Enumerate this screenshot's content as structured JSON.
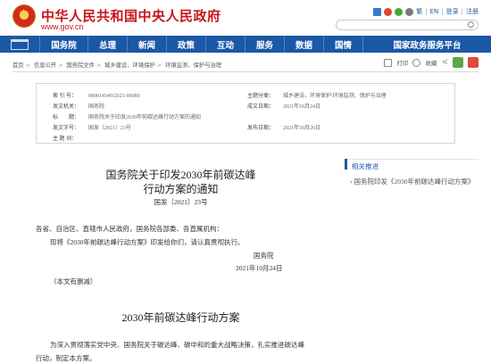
{
  "header": {
    "site_title": "中华人民共和国中央人民政府",
    "site_url": "www.gov.cn",
    "tools": [
      "繁",
      "EN",
      "登录",
      "注册"
    ],
    "search_placeholder": ""
  },
  "nav": {
    "items": [
      "国务院",
      "总理",
      "新闻",
      "政策",
      "互动",
      "服务",
      "数据",
      "国情",
      "国家政务服务平台"
    ]
  },
  "breadcrumb": {
    "items": [
      "首页",
      "信息公开",
      "国务院文件",
      "城乡建设、环境保护",
      "环境监测、保护与治理"
    ]
  },
  "share": {
    "print_label": "打印",
    "bookmark_label": "收藏",
    "share_label": "分享"
  },
  "info": {
    "rows": [
      {
        "k": "索 引 号：",
        "v": "000014349/2021-00080"
      },
      {
        "k": "发文机关：",
        "v": "国务院"
      },
      {
        "k": "标　　题：",
        "v": "国务院关于印发2030年前碳达峰行动方案的通知"
      },
      {
        "k": "发文字号：",
        "v": "国发〔2021〕23号"
      },
      {
        "k": "主 题 词：",
        "v": ""
      },
      {
        "k": "主题分类：",
        "v": "城乡建设、环境保护\\环境监测、保护与治理"
      },
      {
        "k": "成文日期：",
        "v": "2021年10月24日"
      },
      {
        "k": "发布日期：",
        "v": "2021年10月26日"
      }
    ]
  },
  "doc": {
    "title_line1": "国务院关于印发2030年前碳达峰",
    "title_line2": "行动方案的通知",
    "number": "国发〔2021〕23号",
    "salutation": "各省、自治区、直辖市人民政府，国务院各部委、各直属机构：",
    "body": "现将《2030年前碳达峰行动方案》印发给你们，请认真贯彻执行。",
    "signer": "国务院",
    "date": "2021年10月24日",
    "note": "（本文有删减）",
    "plan_title": "2030年前碳达峰行动方案",
    "intro_line1": "为深入贯彻落实党中央、国务院关于碳达峰、碳中和的重大战略决策，扎实推进碳达峰",
    "intro_line2": "行动，制定本方案。"
  },
  "sidebar": {
    "heading": "相关推进",
    "items": [
      "国务院印发《2030年前碳达峰行动方案》"
    ]
  },
  "colors": {
    "brand_red": "#c8161d",
    "nav_blue": "#1b58a6"
  }
}
